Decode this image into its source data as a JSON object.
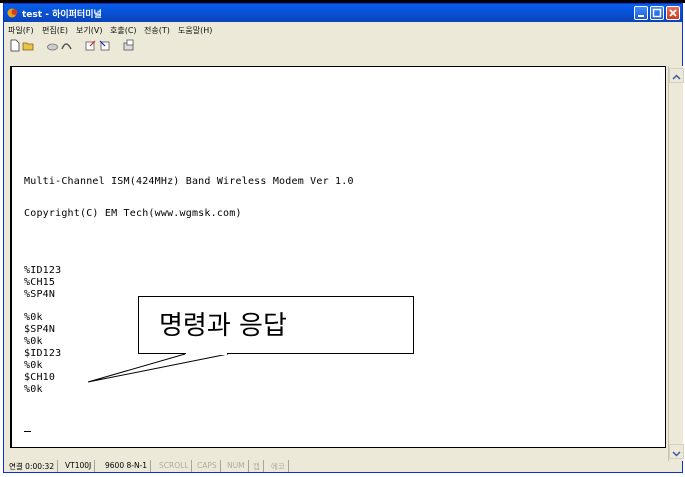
{
  "window": {
    "title": "test - 하이퍼터미널"
  },
  "menu": [
    "파일(F)",
    "편집(E)",
    "보기(V)",
    "호출(C)",
    "전송(T)",
    "도움말(H)"
  ],
  "toolbar_icons": [
    "new-document-icon",
    "open-folder-icon",
    "call-icon",
    "disconnect-icon",
    "send-icon",
    "receive-icon",
    "properties-icon"
  ],
  "terminal": {
    "lines": [
      "Multi-Channel ISM(424MHz) Band Wireless Modem Ver 1.0",
      "Copyright(C) EM Tech(www.wgmsk.com)",
      "%ID123",
      "%CH15",
      "%SP4N",
      "%0k",
      "$SP4N",
      "%0k",
      "$ID123",
      "%0k",
      "$CH10",
      "%0k"
    ]
  },
  "status": {
    "connected": "연결 0:00:32",
    "emulation": "VT100J",
    "port_settings": "9600 8-N-1",
    "scroll": "SCROLL",
    "caps": "CAPS",
    "num": "NUM",
    "capture": "캡",
    "print_echo": "에코"
  },
  "callout": {
    "text": "명령과 응답"
  },
  "colors": {
    "titlebar": "#0653da",
    "close": "#c93e22",
    "chrome": "#ece9d8"
  }
}
